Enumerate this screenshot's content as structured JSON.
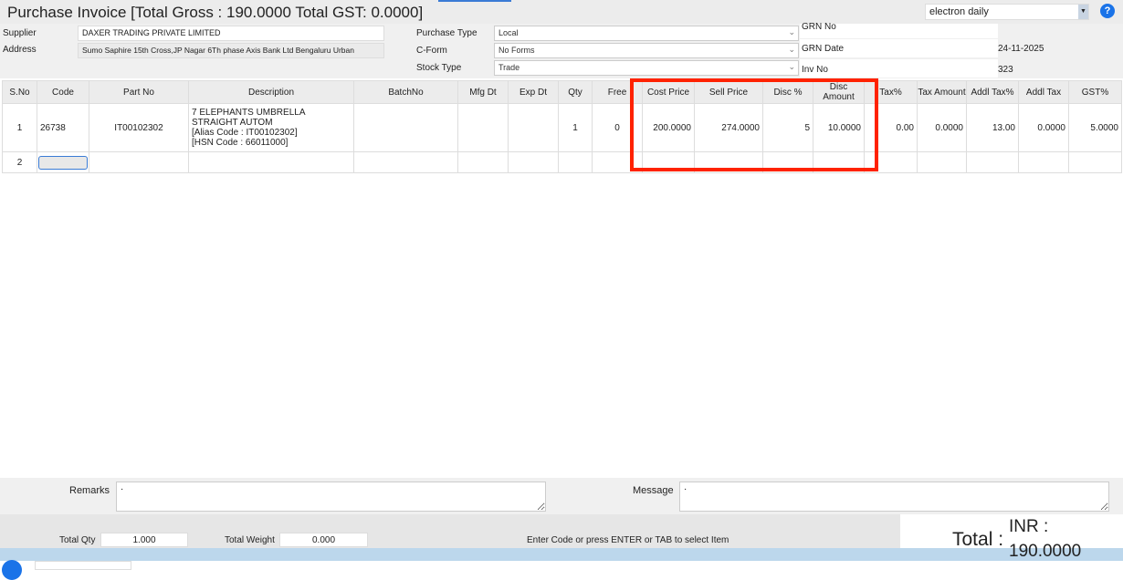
{
  "title": "Purchase Invoice [Total Gross : 190.0000 Total GST: 0.0000]",
  "company_select": "electron daily",
  "help_icon": "?",
  "form": {
    "supplier_label": "Supplier",
    "supplier": "DAXER TRADING PRIVATE LIMITED",
    "address_label": "Address",
    "address": "Sumo Saphire 15th Cross,JP Nagar 6Th phase Axis Bank Ltd Bengaluru Urban",
    "purchase_type_label": "Purchase Type",
    "purchase_type": "Local",
    "cform_label": "C-Form",
    "cform": "No Forms",
    "stock_type_label": "Stock Type",
    "stock_type": "Trade",
    "grn_no_label": "GRN No",
    "grn_no": "",
    "grn_date_label": "GRN Date",
    "grn_date": "24-11-2025",
    "inv_no_label": "Inv No",
    "inv_no": "323"
  },
  "table": {
    "headers": [
      "S.No",
      "Code",
      "Part No",
      "Description",
      "BatchNo",
      "Mfg Dt",
      "Exp Dt",
      "Qty",
      "Free",
      "Cost Price",
      "Sell Price",
      "Disc %",
      "Disc Amount",
      "Tax%",
      "Tax Amount",
      "Addl Tax%",
      "Addl Tax",
      "GST%"
    ],
    "rows": [
      {
        "sno": "1",
        "code": "26738",
        "part_no": "IT00102302",
        "desc1": "7 ELEPHANTS UMBRELLA STRAIGHT AUTOM",
        "desc2": "[Alias Code : IT00102302]",
        "desc3": "[HSN Code : 66011000]",
        "batch": "",
        "mfg": "",
        "exp": "",
        "qty": "1",
        "free": "0",
        "cost": "200.0000",
        "sell": "274.0000",
        "disc_pct": "5",
        "disc_amt": "10.0000",
        "tax_pct": "0.00",
        "tax_amt": "0.0000",
        "addl_tax_pct": "13.00",
        "addl_tax": "0.0000",
        "gst_pct": "5.0000"
      },
      {
        "sno": "2"
      }
    ]
  },
  "remarks_label": "Remarks",
  "remarks": "·",
  "message_label": "Message",
  "message": "·",
  "total_qty_label": "Total Qty",
  "total_qty": "1.000",
  "total_weight_label": "Total Weight",
  "total_weight": "0.000",
  "hint": "Enter Code or press ENTER or TAB to select Item",
  "total_label": "Total :",
  "total_currency": "INR :",
  "total_value": "190.0000"
}
